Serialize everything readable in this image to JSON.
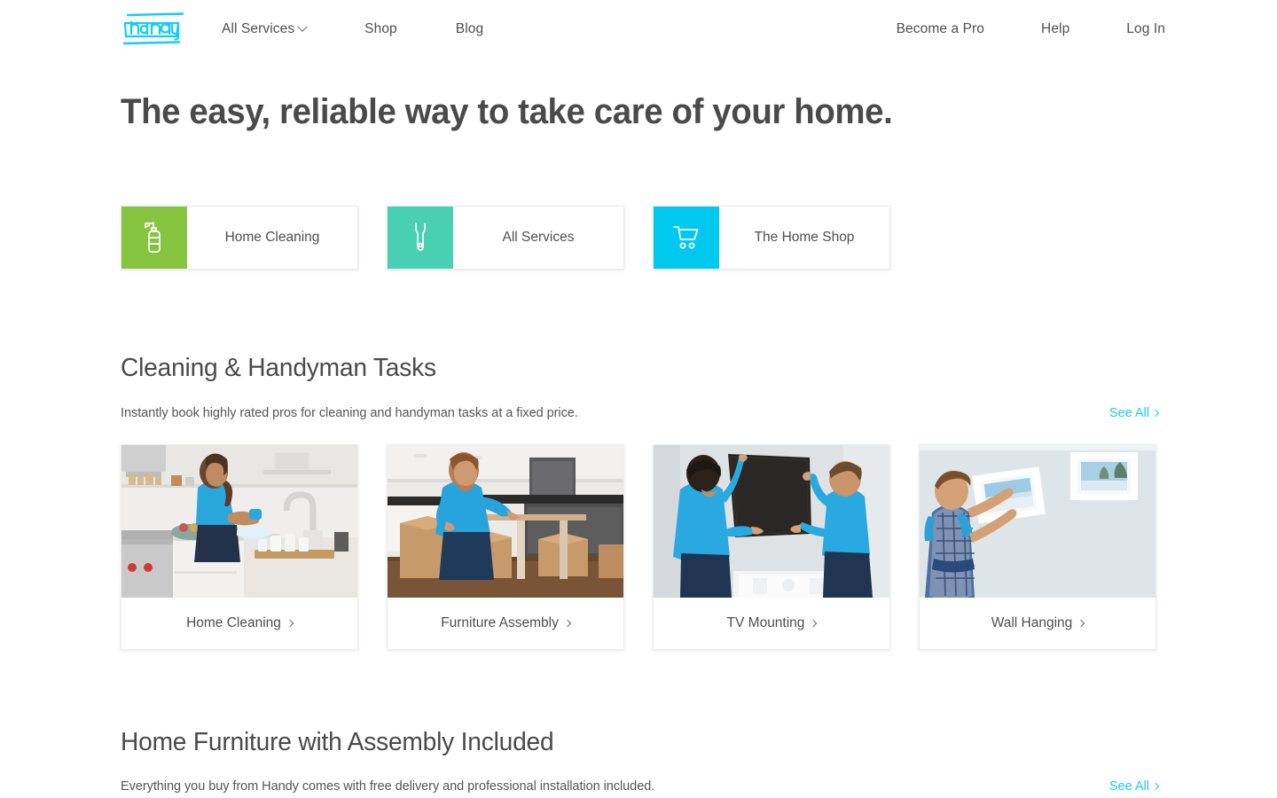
{
  "brand": {
    "logo_text": "handy",
    "accent_cyan": "#1fc8f0",
    "logo_color": "#12cdf0"
  },
  "header": {
    "nav_left": [
      {
        "label": "All Services",
        "icon": "chevron-down-icon",
        "has_dropdown": true
      },
      {
        "label": "Shop",
        "has_dropdown": false
      },
      {
        "label": "Blog",
        "has_dropdown": false
      }
    ],
    "nav_right": [
      {
        "label": "Become a Pro"
      },
      {
        "label": "Help"
      },
      {
        "label": "Log In"
      }
    ]
  },
  "hero": {
    "title": "The easy, reliable way to take care of your home."
  },
  "entry_cards": [
    {
      "label": "Home Cleaning",
      "icon": "spray-bottle-icon",
      "tile_color": "#86c440"
    },
    {
      "label": "All Services",
      "icon": "wrench-icon",
      "tile_color": "#49cfb1"
    },
    {
      "label": "The Home Shop",
      "icon": "shopping-cart-icon",
      "tile_color": "#00c8ef"
    }
  ],
  "sections": [
    {
      "title": "Cleaning & Handyman Tasks",
      "subtitle": "Instantly book highly rated pros for cleaning and handyman tasks at a fixed price.",
      "see_all_label": "See All",
      "cards": [
        {
          "label": "Home Cleaning",
          "image_alt": "woman-in-blue-polo-washing-dishes-in-kitchen"
        },
        {
          "label": "Furniture Assembly",
          "image_alt": "man-in-blue-shirt-assembling-table-with-moving-boxes"
        },
        {
          "label": "TV Mounting",
          "image_alt": "two-men-in-blue-shirts-mounting-flat-screen-tv-on-wall"
        },
        {
          "label": "Wall Hanging",
          "image_alt": "man-in-plaid-shirt-hanging-framed-picture-on-wall"
        }
      ]
    },
    {
      "title": "Home Furniture with Assembly Included",
      "subtitle": "Everything you buy from Handy comes with free delivery and professional installation included.",
      "see_all_label": "See All"
    }
  ]
}
